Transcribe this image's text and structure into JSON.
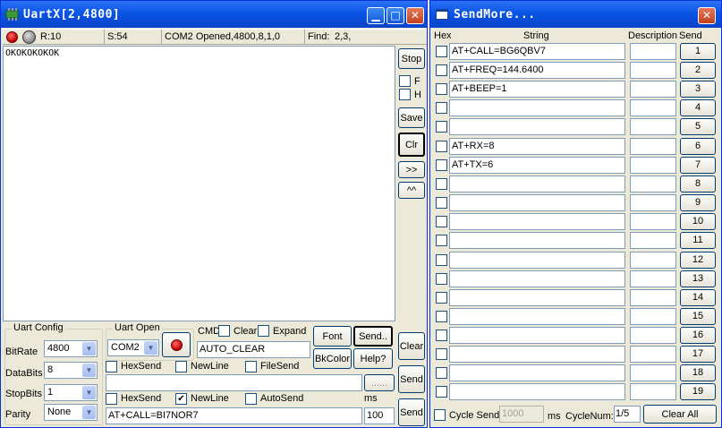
{
  "uartx": {
    "title": "UartX[2,4800]",
    "status": {
      "received": "R:10",
      "sent": "S:54",
      "port_status": "COM2 Opened,4800,8,1,0",
      "find_label": "Find:",
      "find_value": "2,3,"
    },
    "receive_text": "OKOKOKOKOK",
    "side_buttons": {
      "stop": "Stop",
      "f_label": "F",
      "h_label": "H",
      "save": "Save",
      "clr": "Clr",
      "expand": ">>",
      "collapse": "^^",
      "clear": "Clear",
      "send1": "Send",
      "send2": "Send"
    },
    "uart_config": {
      "title": "Uart Config",
      "bitrate_label": "BitRate",
      "bitrate": "4800",
      "databits_label": "DataBits",
      "databits": "8",
      "stopbits_label": "StopBits",
      "stopbits": "1",
      "parity_label": "Parity",
      "parity": "None"
    },
    "uart_open": {
      "title": "Uart Open",
      "port": "COM2"
    },
    "cmd": {
      "cmd_label": "CMD",
      "clear_label": "Clear",
      "expand_label": "Expand",
      "cmd_value": "AUTO_CLEAR",
      "font": "Font",
      "send_more": "Send..",
      "bkcolor": "BkColor",
      "help": "Help?"
    },
    "send_options1": {
      "hexsend": "HexSend",
      "newline": "NewLine",
      "filesend": "FileSend",
      "browse": "......"
    },
    "send_options2": {
      "hexsend": "HexSend",
      "newline": "NewLine",
      "autosend": "AutoSend",
      "ms": "ms"
    },
    "send_input": "AT+CALL=BI7NOR7",
    "interval": "100"
  },
  "sendmore": {
    "title": "SendMore...",
    "headers": {
      "hex": "Hex",
      "string": "String",
      "description": "Description",
      "send": "Send"
    },
    "rows": [
      {
        "string": "AT+CALL=BG6QBV7",
        "num": "1"
      },
      {
        "string": "AT+FREQ=144.6400",
        "num": "2"
      },
      {
        "string": "AT+BEEP=1",
        "num": "3"
      },
      {
        "string": "",
        "num": "4"
      },
      {
        "string": "",
        "num": "5"
      },
      {
        "string": "AT+RX=8",
        "num": "6"
      },
      {
        "string": "AT+TX=6",
        "num": "7"
      },
      {
        "string": "",
        "num": "8"
      },
      {
        "string": "",
        "num": "9"
      },
      {
        "string": "",
        "num": "10"
      },
      {
        "string": "",
        "num": "11"
      },
      {
        "string": "",
        "num": "12"
      },
      {
        "string": "",
        "num": "13"
      },
      {
        "string": "",
        "num": "14"
      },
      {
        "string": "",
        "num": "15"
      },
      {
        "string": "",
        "num": "16"
      },
      {
        "string": "",
        "num": "17"
      },
      {
        "string": "",
        "num": "18"
      },
      {
        "string": "",
        "num": "19"
      }
    ],
    "footer": {
      "cycle_send": "Cycle Send",
      "cycle_ms_value": "1000",
      "ms": "ms",
      "cyclenum_label": "CycleNum:",
      "cyclenum": "1/5",
      "clear_all": "Clear All"
    }
  }
}
